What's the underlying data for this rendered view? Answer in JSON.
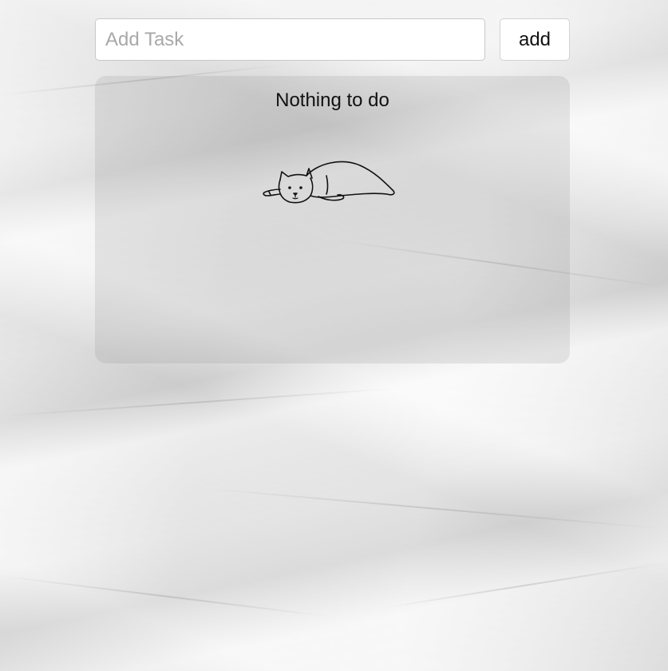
{
  "task_input": {
    "placeholder": "Add Task",
    "value": ""
  },
  "add_button": {
    "label": "add"
  },
  "task_list": {
    "empty_message": "Nothing to do",
    "illustration": "sleeping-cat-icon"
  }
}
